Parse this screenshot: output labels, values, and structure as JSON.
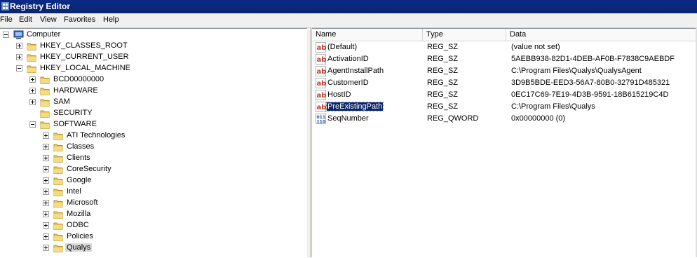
{
  "window": {
    "title": "Registry Editor"
  },
  "menu": [
    "File",
    "Edit",
    "View",
    "Favorites",
    "Help"
  ],
  "tree": [
    {
      "label": "Computer",
      "level": 0,
      "expander": "minus",
      "icon": "computer-icon"
    },
    {
      "label": "HKEY_CLASSES_ROOT",
      "level": 1,
      "expander": "plus",
      "icon": "folder-icon"
    },
    {
      "label": "HKEY_CURRENT_USER",
      "level": 1,
      "expander": "plus",
      "icon": "folder-icon"
    },
    {
      "label": "HKEY_LOCAL_MACHINE",
      "level": 1,
      "expander": "minus",
      "icon": "folder-icon"
    },
    {
      "label": "BCD00000000",
      "level": 2,
      "expander": "plus",
      "icon": "folder-icon"
    },
    {
      "label": "HARDWARE",
      "level": 2,
      "expander": "plus",
      "icon": "folder-icon"
    },
    {
      "label": "SAM",
      "level": 2,
      "expander": "plus",
      "icon": "folder-icon"
    },
    {
      "label": "SECURITY",
      "level": 2,
      "expander": "none",
      "icon": "folder-icon"
    },
    {
      "label": "SOFTWARE",
      "level": 2,
      "expander": "minus",
      "icon": "folder-icon"
    },
    {
      "label": "ATI Technologies",
      "level": 3,
      "expander": "plus",
      "icon": "folder-icon"
    },
    {
      "label": "Classes",
      "level": 3,
      "expander": "plus",
      "icon": "folder-icon"
    },
    {
      "label": "Clients",
      "level": 3,
      "expander": "plus",
      "icon": "folder-icon"
    },
    {
      "label": "CoreSecurity",
      "level": 3,
      "expander": "plus",
      "icon": "folder-icon"
    },
    {
      "label": "Google",
      "level": 3,
      "expander": "plus",
      "icon": "folder-icon"
    },
    {
      "label": "Intel",
      "level": 3,
      "expander": "plus",
      "icon": "folder-icon"
    },
    {
      "label": "Microsoft",
      "level": 3,
      "expander": "plus",
      "icon": "folder-icon"
    },
    {
      "label": "Mozilla",
      "level": 3,
      "expander": "plus",
      "icon": "folder-icon"
    },
    {
      "label": "ODBC",
      "level": 3,
      "expander": "plus",
      "icon": "folder-icon"
    },
    {
      "label": "Policies",
      "level": 3,
      "expander": "plus",
      "icon": "folder-icon"
    },
    {
      "label": "Qualys",
      "level": 3,
      "expander": "plus",
      "icon": "folder-icon",
      "selected": true
    }
  ],
  "list": {
    "columns": [
      "Name",
      "Type",
      "Data"
    ],
    "rows": [
      {
        "name": "(Default)",
        "type": "REG_SZ",
        "data": "(value not set)",
        "icon": "string-value-icon"
      },
      {
        "name": "ActivationID",
        "type": "REG_SZ",
        "data": "5AEBB938-82D1-4DEB-AF0B-F7838C9AEBDF",
        "icon": "string-value-icon"
      },
      {
        "name": "AgentInstallPath",
        "type": "REG_SZ",
        "data": "C:\\Program Files\\Qualys\\QualysAgent",
        "icon": "string-value-icon"
      },
      {
        "name": "CustomerID",
        "type": "REG_SZ",
        "data": "3D9B5BDE-EED3-56A7-80B0-32791D485321",
        "icon": "string-value-icon"
      },
      {
        "name": "HostID",
        "type": "REG_SZ",
        "data": "0EC17C69-7E19-4D3B-9591-18B615219C4D",
        "icon": "string-value-icon"
      },
      {
        "name": "PreExistingPath",
        "type": "REG_SZ",
        "data": "C:\\Program Files\\Qualys",
        "icon": "string-value-icon",
        "selected": true
      },
      {
        "name": "SeqNumber",
        "type": "REG_QWORD",
        "data": "0x00000000 (0)",
        "icon": "binary-value-icon"
      }
    ]
  }
}
